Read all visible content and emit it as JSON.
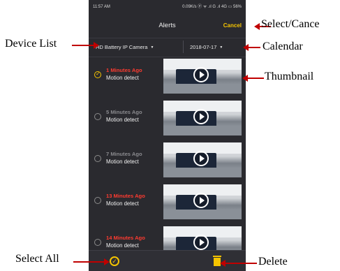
{
  "status_bar": {
    "time": "11:57 AM",
    "indicators": "0.09K/s ⓟ ᯤ .ıl G .ıl 4G ▭ 56%"
  },
  "header": {
    "title": "Alerts",
    "cancel_label": "Cancel"
  },
  "selectors": {
    "device": "HD Battery IP Camera",
    "date": "2018-07-17",
    "caret": "▼"
  },
  "alerts": [
    {
      "time_ago": "1 Minutes Ago",
      "event": "Motion detect",
      "selected": true,
      "time_color": "#ff3b30"
    },
    {
      "time_ago": "5 Minutes Ago",
      "event": "Motion detect",
      "selected": false,
      "time_color": "#8a8a8e"
    },
    {
      "time_ago": "7 Minutes Ago",
      "event": "Motion detect",
      "selected": false,
      "time_color": "#8a8a8e"
    },
    {
      "time_ago": "13 Minutes Ago",
      "event": "Motion detect",
      "selected": false,
      "time_color": "#ff3b30"
    },
    {
      "time_ago": "14 Minutes Ago",
      "event": "Motion detect",
      "selected": false,
      "time_color": "#ff3b30"
    }
  ],
  "annotations": {
    "select_cancel": "Select/Cance",
    "device_list": "Device List",
    "calendar": "Calendar",
    "thumbnail": "Thumbnail",
    "select_all": "Select All",
    "delete": "Delete"
  },
  "colors": {
    "accent": "#f5c400",
    "arrow": "#c00000",
    "background": "#2a2a2f"
  },
  "icons": {
    "select_all": "check-circle-icon",
    "delete": "trash-icon",
    "play": "play-icon"
  }
}
